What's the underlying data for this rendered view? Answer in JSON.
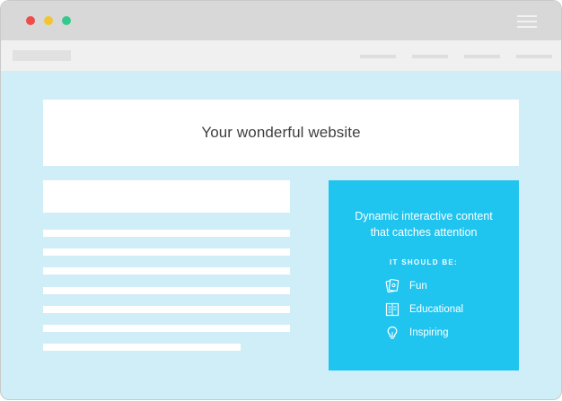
{
  "hero": {
    "title": "Your wonderful website"
  },
  "card": {
    "heading_line1": "Dynamic interactive content",
    "heading_line2": "that catches attention",
    "subheading": "IT SHOULD BE:",
    "items": [
      {
        "label": "Fun",
        "icon": "card-icon"
      },
      {
        "label": "Educational",
        "icon": "book-icon"
      },
      {
        "label": "Inspiring",
        "icon": "lightbulb-icon"
      }
    ]
  },
  "colors": {
    "page_bg": "#cfeef7",
    "card_bg": "#1fc4ef",
    "close_dot": "#f04a4a",
    "minimize_dot": "#f4c430",
    "maximize_dot": "#35c98c"
  }
}
